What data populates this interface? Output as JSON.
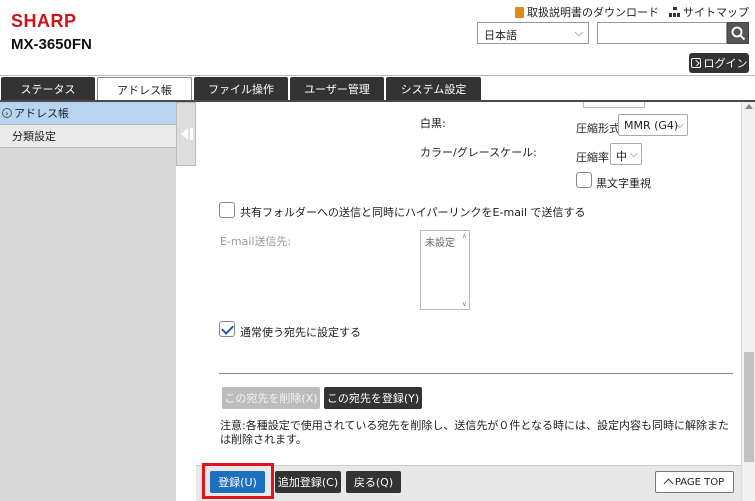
{
  "brand": {
    "logo": "SHARP",
    "model": "MX-3650FN"
  },
  "toplinks": {
    "manual": "取扱説明書のダウンロード",
    "sitemap": "サイトマップ"
  },
  "language": {
    "selected": "日本語"
  },
  "search": {
    "value": ""
  },
  "login": {
    "label": "ログイン"
  },
  "tabs": [
    {
      "label": "ステータス"
    },
    {
      "label": "アドレス帳"
    },
    {
      "label": "ファイル操作"
    },
    {
      "label": "ユーザー管理"
    },
    {
      "label": "システム設定"
    }
  ],
  "sidebar": {
    "items": [
      {
        "label": "アドレス帳"
      },
      {
        "label": "分類設定"
      }
    ]
  },
  "form": {
    "bw_label": "白黒:",
    "compression_label": "圧縮形式:",
    "compression_value": "MMR (G4)",
    "color_label": "カラー/グレースケール:",
    "ratio_label": "圧縮率:",
    "ratio_value": "中",
    "black_text_label": "黒文字重視",
    "hyperlink_label": "共有フォルダーへの送信と同時にハイパーリンクをE-mail で送信する",
    "email_dest_label": "E-mail送信先:",
    "email_dest_value": "未設定",
    "default_dest_label": "通常使う宛先に設定する"
  },
  "actions": {
    "delete_dest": "この宛先を削除(X)",
    "register_dest": "この宛先を登録(Y)"
  },
  "note": "注意:各種設定で使用されている宛先を削除し、送信先が０件となる時には、設定内容も同時に解除または削除されます。",
  "footer": {
    "register": "登録(U)",
    "add_register": "追加登録(C)",
    "back": "戻る(Q)",
    "page_top": "PAGE TOP"
  }
}
